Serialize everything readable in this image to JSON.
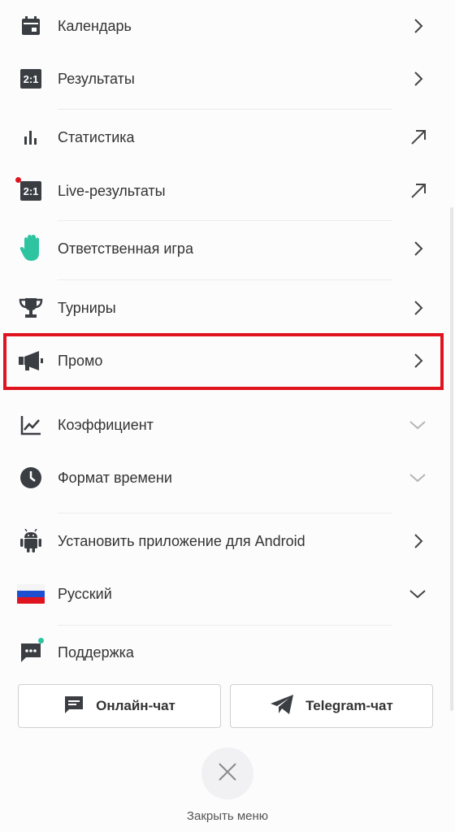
{
  "menu": {
    "items": [
      {
        "label": "Календарь",
        "icon": "calendar-icon",
        "arrow": "chevron-right"
      },
      {
        "label": "Результаты",
        "icon": "score-icon",
        "arrow": "chevron-right"
      },
      {
        "label": "Статистика",
        "icon": "bar-chart-icon",
        "arrow": "external-arrow"
      },
      {
        "label": "Live-результаты",
        "icon": "live-score-icon",
        "arrow": "external-arrow"
      },
      {
        "label": "Ответственная игра",
        "icon": "hand-icon",
        "arrow": "chevron-right"
      },
      {
        "label": "Турниры",
        "icon": "trophy-icon",
        "arrow": "chevron-right"
      },
      {
        "label": "Промо",
        "icon": "megaphone-icon",
        "arrow": "chevron-right"
      },
      {
        "label": "Коэффициент",
        "icon": "trend-icon",
        "arrow": "chevron-down"
      },
      {
        "label": "Формат времени",
        "icon": "clock-icon",
        "arrow": "chevron-down"
      },
      {
        "label": "Установить приложение для Android",
        "icon": "android-icon",
        "arrow": "chevron-right"
      },
      {
        "label": "Русский",
        "icon": "russia-flag-icon",
        "arrow": "chevron-down"
      },
      {
        "label": "Поддержка",
        "icon": "chat-bubble-icon",
        "arrow": ""
      }
    ],
    "score_icon_text": "2:1"
  },
  "support": {
    "online_chat_label": "Онлайн-чат",
    "telegram_chat_label": "Telegram-чат"
  },
  "footer": {
    "close_label": "Закрыть меню"
  },
  "colors": {
    "highlight": "#e0141f",
    "hand_icon": "#2ec4a0",
    "live_dot": "#e0141f",
    "support_dot": "#2ec4a0",
    "icon_dark": "#3a3d42"
  }
}
